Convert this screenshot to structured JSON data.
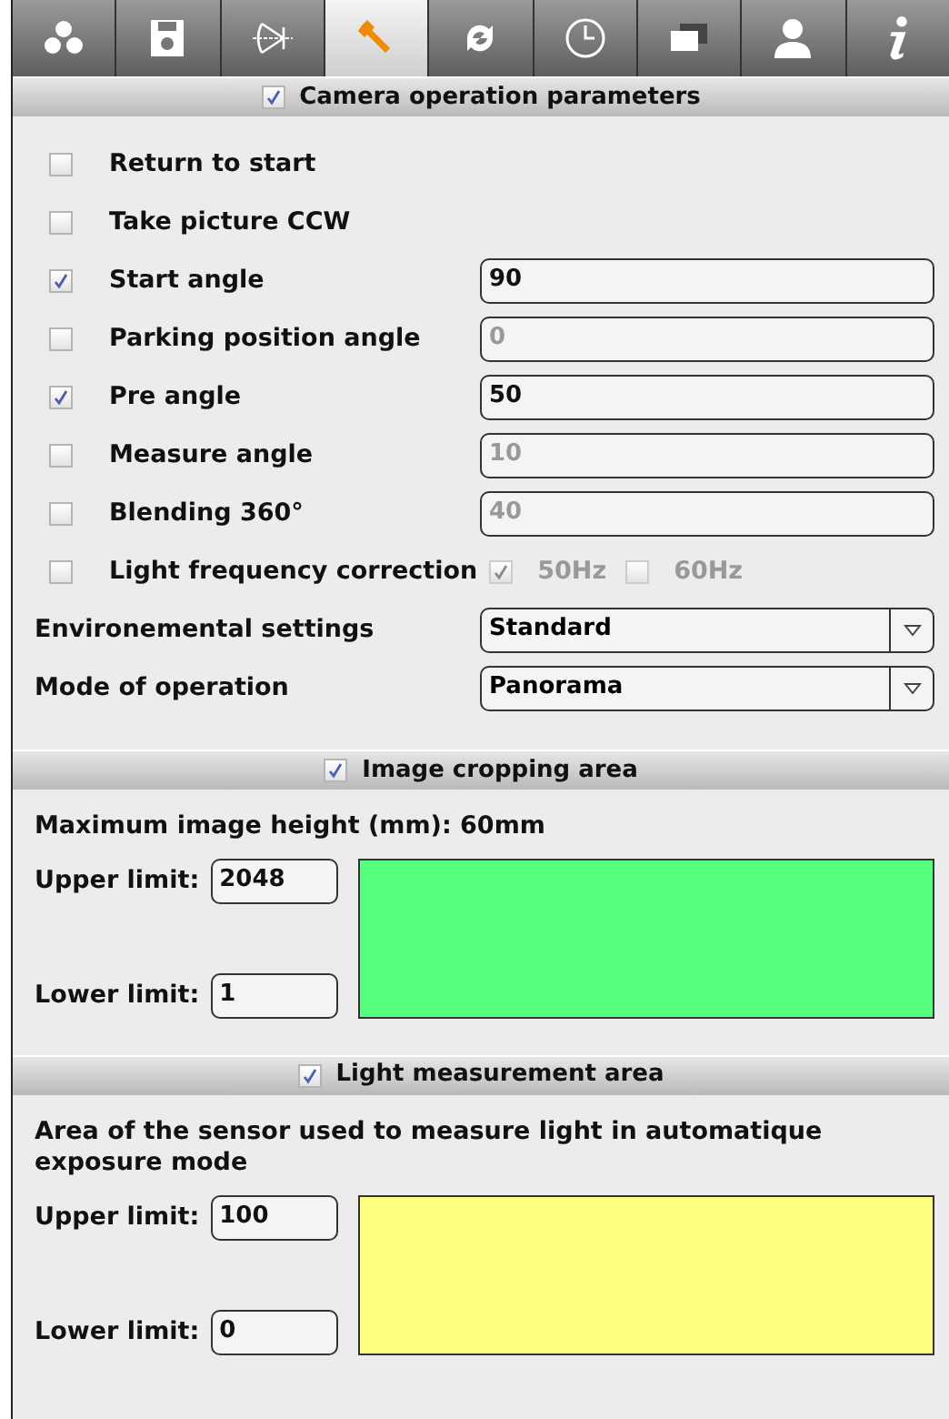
{
  "tabs": [
    {
      "kind": "dots",
      "selected": false
    },
    {
      "kind": "floppy",
      "selected": false
    },
    {
      "kind": "lens",
      "selected": false
    },
    {
      "kind": "wrench",
      "selected": true
    },
    {
      "kind": "refresh",
      "selected": false
    },
    {
      "kind": "clock",
      "selected": false
    },
    {
      "kind": "windows",
      "selected": false
    },
    {
      "kind": "person",
      "selected": false
    },
    {
      "kind": "info",
      "selected": false
    }
  ],
  "sections": [
    {
      "kind": "settings",
      "title": "Camera operation parameters",
      "checked": true,
      "rows": [
        {
          "kind": "check",
          "label": "Return to start",
          "checked": false
        },
        {
          "kind": "check",
          "label": "Take picture CCW",
          "checked": false
        },
        {
          "kind": "check",
          "label": "Start angle",
          "checked": true,
          "value": "90"
        },
        {
          "kind": "check",
          "label": "Parking position angle",
          "checked": false,
          "value": "0"
        },
        {
          "kind": "check",
          "label": "Pre angle",
          "checked": true,
          "value": "50"
        },
        {
          "kind": "check",
          "label": "Measure angle",
          "checked": false,
          "value": "10"
        },
        {
          "kind": "check",
          "label": "Blending 360°",
          "checked": false,
          "value": "40"
        },
        {
          "kind": "frequency",
          "label": "Light frequency correction",
          "checked": false,
          "options": [
            {
              "label": "50Hz",
              "checked": true
            },
            {
              "label": "60Hz",
              "checked": false
            }
          ]
        },
        {
          "kind": "select",
          "label": "Environemental settings",
          "value": "Standard"
        },
        {
          "kind": "select",
          "label": "Mode of operation",
          "value": "Panorama"
        }
      ]
    },
    {
      "kind": "area",
      "title": "Image cropping area",
      "checked": true,
      "note": "Maximum image height (mm): 60mm",
      "color": "#55ff7f",
      "limits": [
        {
          "label": "Upper limit:",
          "value": "2048"
        },
        {
          "label": "Lower limit:",
          "value": "1"
        }
      ]
    },
    {
      "kind": "area",
      "title": "Light measurement area",
      "checked": true,
      "note": "Area of the sensor used to measure light in automatique exposure mode",
      "color": "#ffff7f",
      "limits": [
        {
          "label": "Upper limit:",
          "value": "100"
        },
        {
          "label": "Lower limit:",
          "value": "0"
        }
      ]
    }
  ]
}
